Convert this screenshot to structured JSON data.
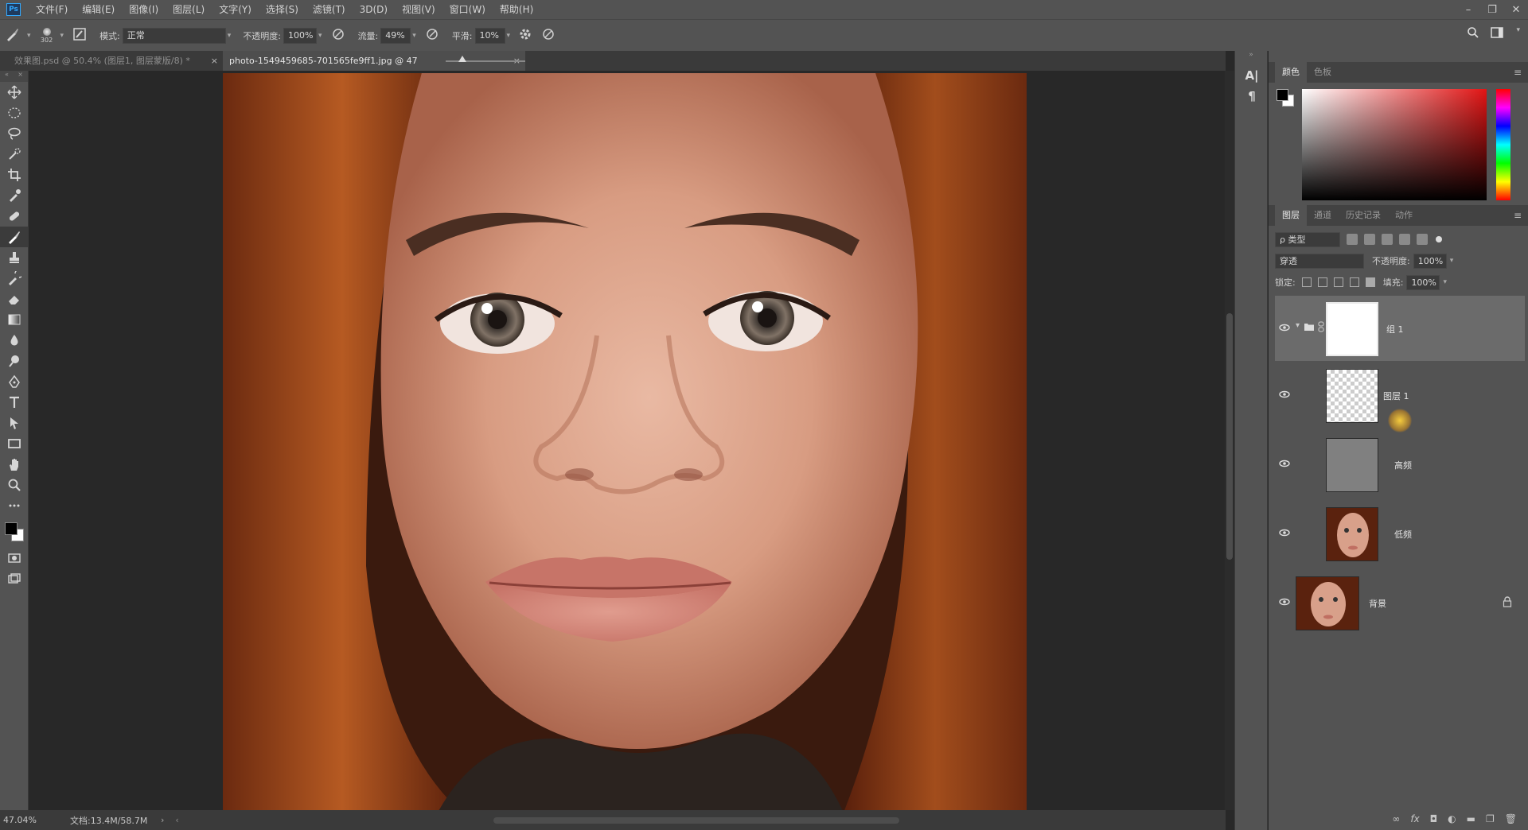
{
  "app": {
    "logo": "Ps",
    "menu": [
      "文件(F)",
      "编辑(E)",
      "图像(I)",
      "图层(L)",
      "文字(Y)",
      "选择(S)",
      "滤镜(T)",
      "3D(D)",
      "视图(V)",
      "窗口(W)",
      "帮助(H)"
    ],
    "window_controls": [
      "–",
      "❐",
      "✕"
    ]
  },
  "options": {
    "brush_size": "302",
    "mode_label": "模式:",
    "mode_value": "正常",
    "opacity_label": "不透明度:",
    "opacity_value": "100%",
    "flow_label": "流量:",
    "flow_value": "49%",
    "smoothing_label": "平滑:",
    "smoothing_value": "10%"
  },
  "tabs": [
    {
      "label": "效果图.psd @ 50.4% (图层1, 图层蒙版/8) *"
    },
    {
      "label": "photo-1549459685-701565fe9ff1.jpg @ 47"
    }
  ],
  "status": {
    "zoom": "47.04%",
    "doc": "文档:13.4M/58.7M"
  },
  "color_panel": {
    "tabs": [
      "颜色",
      "色板"
    ],
    "field_hue": "#e11414"
  },
  "layers_panel": {
    "tabs": [
      "图层",
      "通道",
      "历史记录",
      "动作"
    ],
    "filter_label": "ρ 类型",
    "blend_mode": "穿透",
    "opacity_label": "不透明度:",
    "opacity_value": "100%",
    "lock_label": "锁定:",
    "fill_label": "填充:",
    "fill_value": "100%",
    "layers": [
      {
        "name": "组 1",
        "type": "group",
        "selected": true
      },
      {
        "name": "图层 1",
        "type": "transparent"
      },
      {
        "name": "高频",
        "type": "gray"
      },
      {
        "name": "低频",
        "type": "photo"
      },
      {
        "name": "背景",
        "type": "photo",
        "locked": true
      }
    ],
    "footer_icons": [
      "link-icon",
      "fx-icon",
      "mask-icon",
      "adjustment-icon",
      "folder-icon",
      "new-layer-icon",
      "trash-icon"
    ]
  },
  "colors": {
    "chrome": "#535353",
    "canvas_bg": "#282828",
    "accent": "#31a8ff"
  }
}
